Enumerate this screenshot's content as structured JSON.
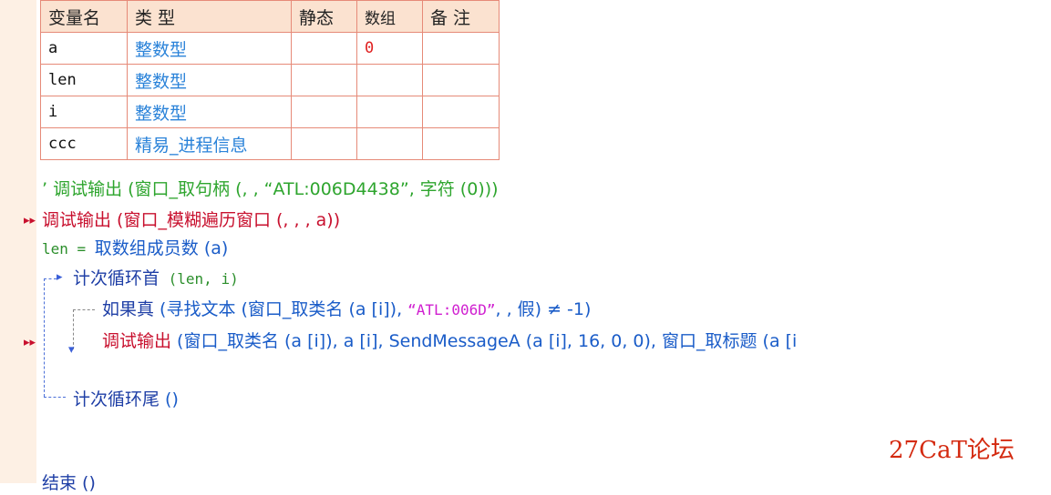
{
  "var_table": {
    "headers": [
      "变量名",
      "类 型",
      "静态",
      "数组",
      "备 注"
    ],
    "rows": [
      {
        "name": "a",
        "type": "整数型",
        "static": "",
        "array": "0",
        "note": ""
      },
      {
        "name": "len",
        "type": "整数型",
        "static": "",
        "array": "",
        "note": ""
      },
      {
        "name": "i",
        "type": "整数型",
        "static": "",
        "array": "",
        "note": ""
      },
      {
        "name": "ccc",
        "type": "精易_进程信息",
        "static": "",
        "array": "",
        "note": ""
      }
    ]
  },
  "code": {
    "l1": {
      "comment": "’ 调试输出 (窗口_取句柄 (, ,  “ATL:006D4438”, 字符 (0)))"
    },
    "l2": {
      "call": "调试输出 (窗口_模糊遍历窗口 (, , , a))"
    },
    "l3": {
      "a": "len = ",
      "b": "取数组成员数 (a)"
    },
    "l4": {
      "kw": "计次循环首",
      "args": " (len, i)"
    },
    "l5": {
      "kw": "如果真",
      "p1": " (寻找文本 (窗口_取类名 (a [i]), ",
      "str": "“ATL:006D”",
      "p2": ", , 假) ≠ -1)"
    },
    "l6": {
      "kw": "调试输出",
      "p1": " (窗口_取类名 (a [i]), a [i], SendMessageA (a [i], 16, 0, 0), 窗口_取标题 (a [i"
    },
    "l7": {
      "kw": "计次循环尾",
      "args": " ()"
    },
    "l8": {
      "text": "结束 ()"
    }
  },
  "watermark": "27CaT论坛",
  "colors": {
    "gutter": "#fdf0e4",
    "table_border": "#e68a78",
    "type_blue": "#2b83d9",
    "comment_green": "#2ea52e",
    "call_red": "#c8102e"
  }
}
